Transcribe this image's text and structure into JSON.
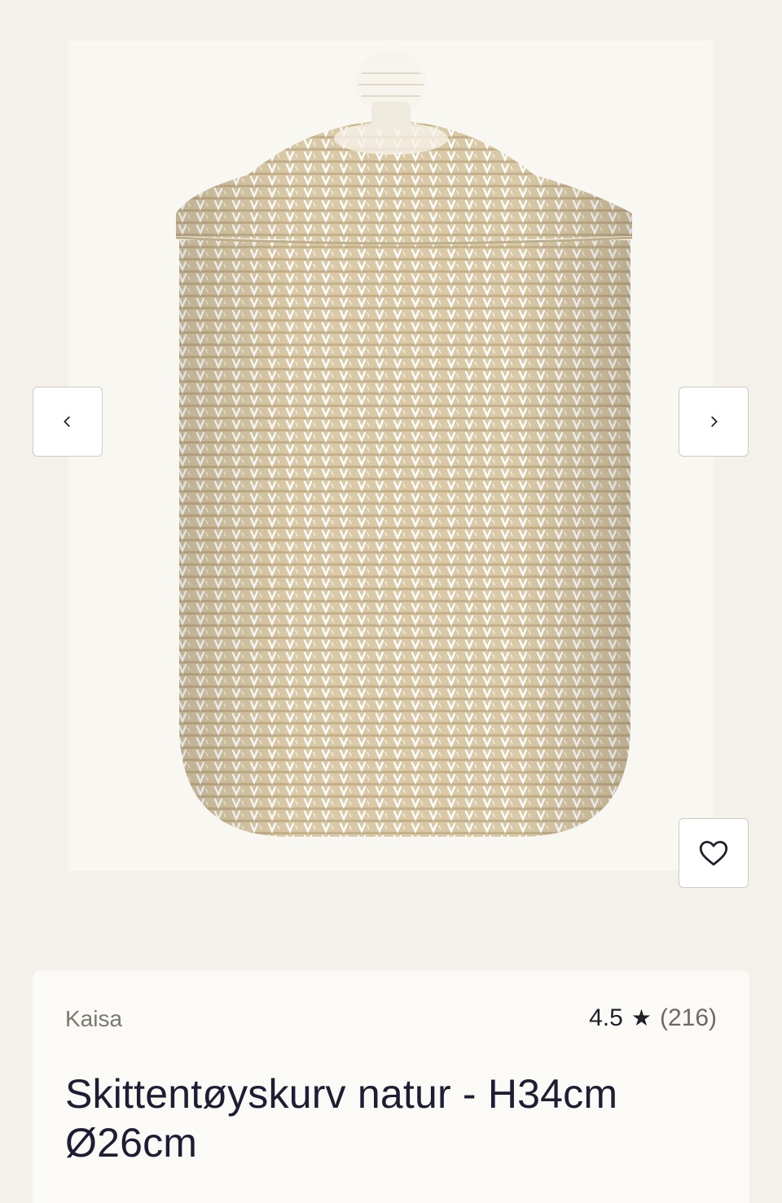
{
  "carousel": {
    "prev_icon": "chevron-left-icon",
    "next_icon": "chevron-right-icon",
    "favorite_icon": "heart-icon"
  },
  "product": {
    "brand": "Kaisa",
    "rating_value": "4.5",
    "rating_star": "★",
    "rating_count": "(216)",
    "title": "Skittentøyskurv natur - H34cm Ø26cm"
  },
  "colors": {
    "background": "#f4f1ea",
    "card": "#fbfaf6",
    "title_text": "#1e1d33",
    "basket_straw": "#d8c7a4",
    "basket_stitch": "#ffffff"
  }
}
